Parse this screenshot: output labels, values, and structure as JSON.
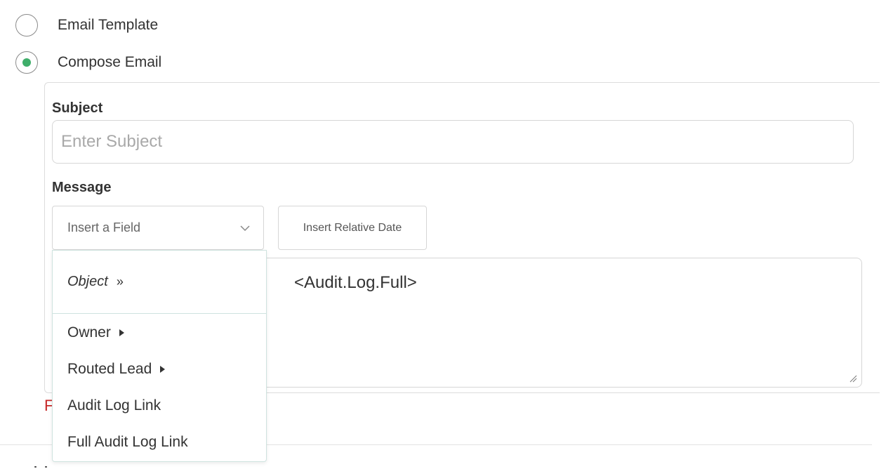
{
  "email_type": {
    "options": [
      {
        "label": "Email Template",
        "selected": false
      },
      {
        "label": "Compose Email",
        "selected": true
      }
    ],
    "accent_color": "#3fae6a"
  },
  "compose": {
    "subject_label": "Subject",
    "subject_placeholder": "Enter Subject",
    "message_label": "Message",
    "insert_field_placeholder": "Insert a Field",
    "insert_relative_date_label": "Insert Relative Date",
    "message_body": "<Audit.Log.Full>"
  },
  "field_dropdown": {
    "header_label": "Object",
    "header_arrow": "»",
    "items": [
      {
        "label": "Owner",
        "has_submenu": true
      },
      {
        "label": "Routed Lead",
        "has_submenu": true
      },
      {
        "label": "Audit Log Link",
        "has_submenu": false
      },
      {
        "label": "Full Audit Log Link",
        "has_submenu": false
      }
    ]
  },
  "error_text_visible": "F",
  "icons": {
    "select_chevron": "chevron-down-icon",
    "submenu": "caret-right-icon",
    "resize": "resize-grip-icon"
  }
}
